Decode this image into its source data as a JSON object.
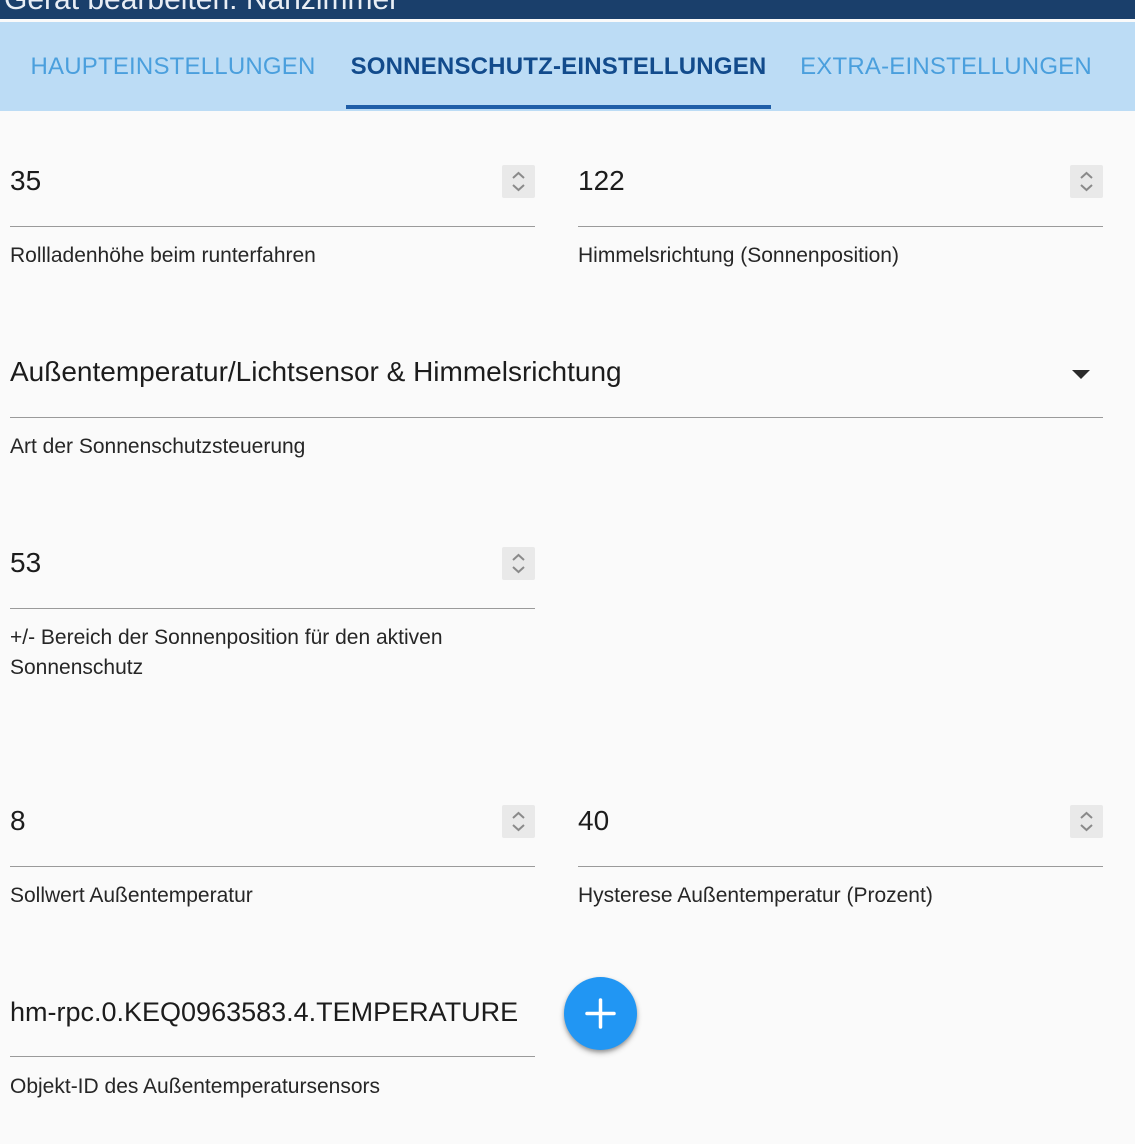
{
  "window": {
    "title": "Gerät bearbeiten: Nähzimmer"
  },
  "tabs": [
    {
      "label": "HAUPTEINSTELLUNGEN",
      "active": false
    },
    {
      "label": "SONNENSCHUTZ-EINSTELLUNGEN",
      "active": true
    },
    {
      "label": "EXTRA-EINSTELLUNGEN",
      "active": false
    }
  ],
  "fields": {
    "shutter_height": {
      "value": "35",
      "label": "Rollladenhöhe beim runterfahren"
    },
    "sun_direction": {
      "value": "122",
      "label": "Himmelsrichtung (Sonnenposition)"
    },
    "control_type": {
      "value": "Außentemperatur/Lichtsensor & Himmelsrichtung",
      "label": "Art der Sonnenschutzsteuerung"
    },
    "sun_range": {
      "value": "53",
      "label_line1": "+/- Bereich der Sonnenposition für den aktiven",
      "label_line2": "Sonnenschutz"
    },
    "outside_temp_setpoint": {
      "value": "8",
      "label": "Sollwert Außentemperatur"
    },
    "outside_temp_hysteresis": {
      "value": "40",
      "label": "Hysterese Außentemperatur (Prozent)"
    },
    "temp_sensor_object_id": {
      "value": "hm-rpc.0.KEQ0963583.4.TEMPERATURE",
      "label": "Objekt-ID des Außentemperatursensors"
    }
  },
  "icons": {
    "spinner": "up-down-chevron-icon",
    "dropdown": "caret-down-icon",
    "add": "plus-icon"
  },
  "colors": {
    "title_bar": "#1a3f6b",
    "tab_bar": "#bcdcf5",
    "tab_active": "#124b8c",
    "tab_inactive": "#4a9fdd",
    "fab": "#2196f3"
  }
}
